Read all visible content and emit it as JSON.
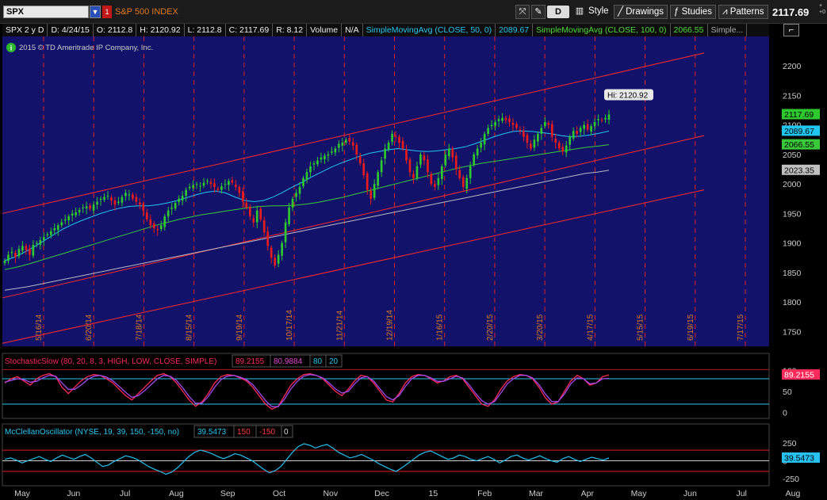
{
  "toolbar": {
    "symbol": "SPX",
    "symbol_name": "S&P 500 INDEX",
    "flag": "1",
    "d_label": "D",
    "style_label": "Style",
    "drawings_label": "Drawings",
    "studies_label": "Studies",
    "patterns_label": "Patterns",
    "last_price": "2117.69",
    "change_top": "+",
    "change_bottom": "+0"
  },
  "infobar": {
    "symbol_period": "SPX 2 y D",
    "date": "D: 4/24/15",
    "open": "O: 2112.8",
    "high": "H: 2120.92",
    "low": "L: 2112.8",
    "close": "C: 2117.69",
    "range": "R: 8.12",
    "volume_label": "Volume",
    "volume_value": "N/A",
    "sma50_label": "SimpleMovingAvg (CLOSE, 50, 0)",
    "sma50_value": "2089.67",
    "sma100_label": "SimpleMovingAvg (CLOSE, 100, 0)",
    "sma100_value": "2066.55",
    "more_label": "Simple..."
  },
  "copyright": "2015 © TD Ameritrade IP Company, Inc.",
  "colors": {
    "chart_bg": "#12126a",
    "up": "#2ec92e",
    "down": "#e81c1c",
    "sma50": "#1fc7f0",
    "sma100": "#3ac93a",
    "sma200": "#b8b8c8",
    "channel": "#ff2a2a",
    "stoch_k": "#ff2a5a",
    "stoch_d": "#a04af0",
    "mcclellan": "#27c0f0"
  },
  "chart_data": [
    {
      "type": "candlestick",
      "ylim": [
        1725,
        2250
      ],
      "y_ticks": [
        1750,
        1800,
        1850,
        1900,
        1950,
        2000,
        2050,
        2100,
        2150,
        2200
      ],
      "month_labels": [
        "May",
        "Jun",
        "Jul",
        "Aug",
        "Sep",
        "Oct",
        "Nov",
        "Dec",
        "15",
        "Feb",
        "Mar",
        "Apr",
        "May",
        "Jun",
        "Jul",
        "Aug"
      ],
      "vertical_date_labels": [
        "5/16/14",
        "6/20/14",
        "7/18/14",
        "8/15/14",
        "9/19/14",
        "10/17/14",
        "11/21/14",
        "12/19/14",
        "1/16/15",
        "2/20/15",
        "3/20/15",
        "4/17/15",
        "5/15/15",
        "6/19/15",
        "7/17/15"
      ],
      "high_annotation": "Hi: 2120.92",
      "price_tags": [
        {
          "label": "2117.69",
          "value": 2117.69,
          "color": "#2ec92e"
        },
        {
          "label": "2089.67",
          "value": 2089.67,
          "color": "#1fc7f0"
        },
        {
          "label": "2066.55",
          "value": 2066.55,
          "color": "#3ac93a"
        },
        {
          "label": "2023.35",
          "value": 2023.35,
          "color": "#c0c0c0"
        }
      ],
      "close_series": [
        1870,
        1880,
        1885,
        1876,
        1890,
        1895,
        1888,
        1880,
        1897,
        1900,
        1905,
        1910,
        1915,
        1920,
        1925,
        1930,
        1935,
        1940,
        1945,
        1950,
        1952,
        1956,
        1960,
        1962,
        1958,
        1965,
        1970,
        1975,
        1978,
        1980,
        1972,
        1965,
        1970,
        1978,
        1985,
        1982,
        1975,
        1970,
        1965,
        1955,
        1940,
        1930,
        1925,
        1922,
        1930,
        1945,
        1955,
        1960,
        1968,
        1975,
        1980,
        1990,
        1995,
        1998,
        2000,
        1997,
        2002,
        2005,
        2000,
        1995,
        1990,
        1996,
        2000,
        2005,
        2002,
        1995,
        1985,
        1970,
        1960,
        1945,
        1935,
        1955,
        1940,
        1918,
        1895,
        1875,
        1862,
        1880,
        1900,
        1935,
        1960,
        1975,
        1985,
        1995,
        2010,
        2020,
        2030,
        2035,
        2040,
        2045,
        2048,
        2050,
        2055,
        2060,
        2068,
        2070,
        2075,
        2072,
        2065,
        2050,
        2035,
        2015,
        1990,
        1975,
        2000,
        2020,
        2040,
        2060,
        2070,
        2085,
        2080,
        2070,
        2060,
        2040,
        2020,
        2010,
        2030,
        2050,
        2040,
        2020,
        2000,
        1995,
        2010,
        2030,
        2050,
        2060,
        2045,
        2025,
        2010,
        1995,
        2010,
        2030,
        2050,
        2060,
        2070,
        2085,
        2095,
        2100,
        2105,
        2110,
        2112,
        2108,
        2105,
        2100,
        2095,
        2090,
        2080,
        2070,
        2060,
        2075,
        2085,
        2095,
        2105,
        2100,
        2080,
        2070,
        2060,
        2055,
        2065,
        2080,
        2090,
        2085,
        2095,
        2100,
        2092,
        2098,
        2105,
        2110,
        2108,
        2112,
        2117.69
      ],
      "sma50_series": [
        1870,
        1876,
        1884,
        1893,
        1903,
        1913,
        1923,
        1931,
        1938,
        1944,
        1950,
        1955,
        1959,
        1962,
        1963,
        1963,
        1965,
        1968,
        1972,
        1977,
        1982,
        1986,
        1988,
        1985,
        1978,
        1972,
        1970,
        1972,
        1978,
        1986,
        1995,
        2003,
        2012,
        2020,
        2028,
        2035,
        2041,
        2047,
        2052,
        2055,
        2058,
        2060,
        2058,
        2056,
        2055,
        2056,
        2058,
        2060,
        2063,
        2068,
        2074,
        2080,
        2085,
        2089,
        2090,
        2089,
        2087,
        2085,
        2082,
        2080,
        2081,
        2083,
        2086,
        2089.67
      ],
      "sma100_series": [
        1855,
        1859,
        1864,
        1870,
        1876,
        1882,
        1888,
        1894,
        1900,
        1906,
        1912,
        1918,
        1924,
        1930,
        1935,
        1940,
        1944,
        1948,
        1951,
        1954,
        1957,
        1960,
        1962,
        1963,
        1963,
        1964,
        1966,
        1969,
        1973,
        1977,
        1982,
        1987,
        1992,
        1997,
        2002,
        2007,
        2012,
        2017,
        2022,
        2027,
        2031,
        2035,
        2038,
        2041,
        2044,
        2047,
        2050,
        2053,
        2056,
        2059,
        2062,
        2064,
        2066.55
      ],
      "sma200_series": [
        1820,
        1823,
        1826,
        1830,
        1834,
        1838,
        1842,
        1846,
        1850,
        1854,
        1858,
        1862,
        1866,
        1870,
        1874,
        1878,
        1882,
        1886,
        1890,
        1894,
        1898,
        1902,
        1906,
        1910,
        1914,
        1918,
        1922,
        1926,
        1930,
        1934,
        1938,
        1942,
        1946,
        1950,
        1954,
        1958,
        1962,
        1966,
        1970,
        1974,
        1978,
        1982,
        1986,
        1990,
        1994,
        1998,
        2002,
        2006,
        2010,
        2014,
        2018,
        2020,
        2023.35
      ]
    },
    {
      "type": "line",
      "title": "StochasticSlow (80, 20, 8, 3, HIGH, LOW, CLOSE, SIMPLE)",
      "k_value": "89.2155",
      "d_value": "80.9884",
      "overbought": "80",
      "oversold": "20",
      "ylim": [
        -10,
        110
      ],
      "y_ticks": [
        0,
        50,
        100
      ],
      "last_tag": "89.2155",
      "series": [
        {
          "name": "FullK",
          "values": [
            70,
            80,
            85,
            75,
            65,
            80,
            88,
            92,
            85,
            60,
            45,
            60,
            75,
            85,
            90,
            88,
            80,
            70,
            55,
            40,
            30,
            45,
            60,
            75,
            88,
            92,
            85,
            70,
            50,
            30,
            15,
            25,
            45,
            70,
            85,
            90,
            88,
            82,
            75,
            60,
            40,
            20,
            8,
            15,
            40,
            65,
            80,
            90,
            92,
            88,
            80,
            65,
            50,
            40,
            55,
            75,
            88,
            85,
            70,
            50,
            30,
            25,
            45,
            70,
            85,
            90,
            88,
            80,
            70,
            75,
            85,
            88,
            80,
            60,
            40,
            20,
            15,
            30,
            55,
            75,
            85,
            90,
            88,
            80,
            60,
            35,
            20,
            25,
            50,
            75,
            88,
            80,
            65,
            70,
            85,
            89.2155
          ]
        },
        {
          "name": "FullD",
          "values": [
            72,
            76,
            80,
            78,
            72,
            74,
            82,
            88,
            86,
            70,
            55,
            55,
            65,
            78,
            86,
            88,
            84,
            75,
            62,
            48,
            36,
            40,
            52,
            66,
            80,
            88,
            86,
            76,
            58,
            38,
            22,
            22,
            38,
            60,
            78,
            86,
            88,
            84,
            78,
            66,
            48,
            28,
            14,
            14,
            32,
            56,
            74,
            86,
            90,
            88,
            82,
            70,
            56,
            46,
            50,
            68,
            82,
            85,
            75,
            56,
            38,
            30,
            40,
            62,
            80,
            88,
            88,
            82,
            74,
            74,
            80,
            86,
            82,
            66,
            46,
            28,
            20,
            26,
            46,
            68,
            80,
            88,
            88,
            82,
            66,
            44,
            26,
            26,
            44,
            68,
            82,
            80,
            68,
            70,
            80,
            80.9884
          ]
        }
      ]
    },
    {
      "type": "line",
      "title": "McClellanOscillator (NYSE, 19, 39, 150, -150, no)",
      "value": "39.5473",
      "upper": "150",
      "lower": "-150",
      "zero": "0",
      "ylim": [
        -330,
        330
      ],
      "y_ticks": [
        250,
        0,
        -250
      ],
      "last_tag": "39.5473",
      "series": [
        {
          "name": "McClellanOscillator",
          "values": [
            20,
            40,
            10,
            -30,
            0,
            30,
            60,
            20,
            -10,
            40,
            80,
            50,
            20,
            60,
            90,
            40,
            -20,
            -80,
            -60,
            -10,
            30,
            70,
            50,
            20,
            -30,
            -80,
            -120,
            -150,
            -190,
            -160,
            -100,
            -20,
            60,
            120,
            150,
            130,
            100,
            60,
            30,
            60,
            100,
            80,
            40,
            0,
            -60,
            -120,
            -170,
            -140,
            -80,
            20,
            120,
            200,
            240,
            220,
            180,
            210,
            230,
            180,
            120,
            80,
            40,
            60,
            90,
            50,
            10,
            -40,
            -80,
            -120,
            -150,
            -100,
            -40,
            20,
            80,
            120,
            140,
            100,
            60,
            20,
            40,
            80,
            60,
            20,
            0,
            30,
            60,
            20,
            -30,
            10,
            60,
            80,
            40,
            10,
            40,
            70,
            30,
            0,
            -20,
            30,
            60,
            20,
            -10,
            20,
            50,
            30,
            10,
            39.5473
          ]
        }
      ]
    }
  ]
}
